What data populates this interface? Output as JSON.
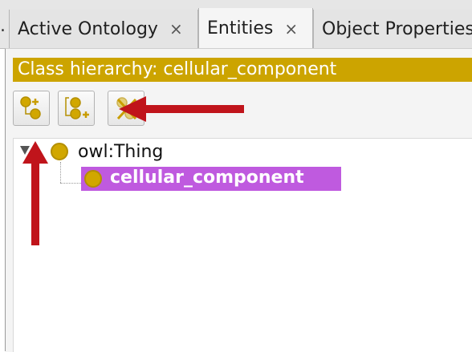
{
  "tabs": {
    "leading_fragment": ".",
    "items": [
      {
        "label": "Active Ontology",
        "close": "×"
      },
      {
        "label": "Entities",
        "close": "×",
        "selected": true
      },
      {
        "label": "Object Properties"
      }
    ]
  },
  "panel": {
    "title": "Class hierarchy: cellular_component"
  },
  "toolbar": {
    "buttons": [
      {
        "icon": "add-subclass-icon"
      },
      {
        "icon": "add-sibling-class-icon"
      },
      {
        "icon": "delete-class-icon"
      }
    ]
  },
  "tree": {
    "root": {
      "label": "owl:Thing",
      "icon": "class-icon",
      "expanded": true
    },
    "children": [
      {
        "label": "cellular_component",
        "icon": "class-icon",
        "selected": true
      }
    ]
  },
  "colors": {
    "header_bg": "#cca400",
    "class_icon": "#d1a700",
    "selection_bg": "#bf5adf",
    "annotation_arrow": "#c0141b"
  }
}
